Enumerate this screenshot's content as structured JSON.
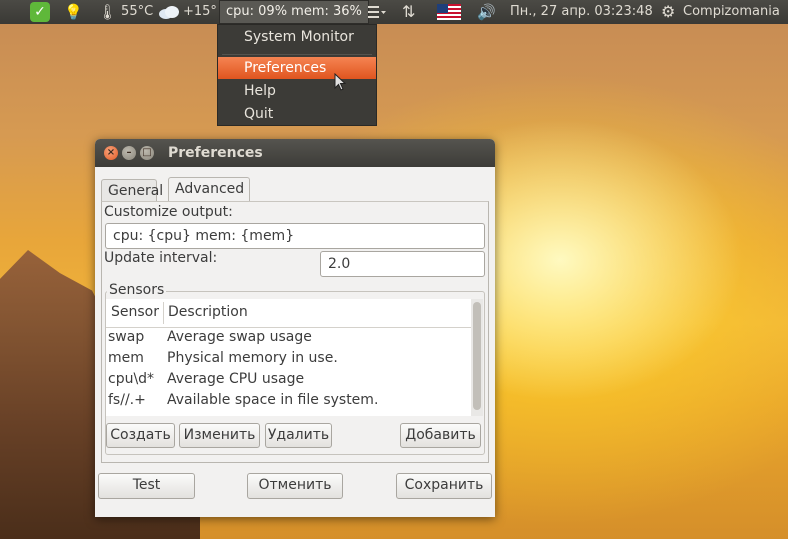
{
  "panel": {
    "temperature": "55°C",
    "weather": "+15°",
    "sysmon_text": "cpu: 09% mem: 36%",
    "clock": "Пн., 27 апр. 03:23:48",
    "user": "Compizomania"
  },
  "menu": {
    "items": [
      "System Monitor",
      "Preferences",
      "Help",
      "Quit"
    ],
    "highlighted": "Preferences",
    "highlight_color": "#e95420"
  },
  "window": {
    "title": "Preferences",
    "tabs": [
      "General",
      "Advanced"
    ],
    "active_tab": "Advanced",
    "customize_label": "Customize output:",
    "customize_value": "cpu: {cpu} mem: {mem}",
    "interval_label": "Update interval:",
    "interval_value": "2.0",
    "sensors_label": "Sensors",
    "columns": [
      "Sensor",
      "Description"
    ],
    "rows": [
      {
        "sensor": "swap",
        "description": "Average swap usage"
      },
      {
        "sensor": "mem",
        "description": "Physical memory in use."
      },
      {
        "sensor": "cpu\\d*",
        "description": "Average CPU usage"
      },
      {
        "sensor": "fs//.+",
        "description": "Available space in file system."
      }
    ],
    "sensor_buttons": {
      "create": "Создать",
      "edit": "Изменить",
      "delete": "Удалить",
      "add": "Добавить"
    },
    "footer_buttons": {
      "test": "Test",
      "cancel": "Отменить",
      "save": "Сохранить"
    }
  }
}
